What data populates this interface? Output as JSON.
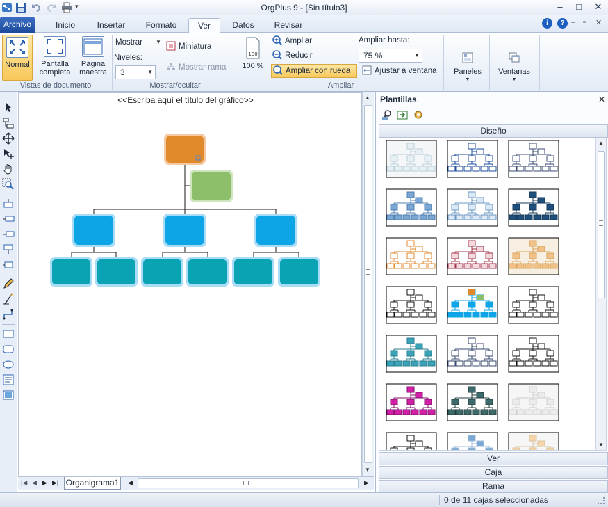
{
  "window": {
    "title": "OrgPlus 9 - [Sin título3]",
    "help_icon": "i",
    "question_icon": "?"
  },
  "tabs": {
    "file": "Archivo",
    "items": [
      "Inicio",
      "Insertar",
      "Formato",
      "Ver",
      "Datos",
      "Revisar"
    ],
    "active": "Ver"
  },
  "ribbon": {
    "vistas": {
      "normal": "Normal",
      "pantalla1": "Pantalla",
      "pantalla2": "completa",
      "pagina1": "Página",
      "pagina2": "maestra",
      "label": "Vistas de documento"
    },
    "mostrar": {
      "mostrar": "Mostrar",
      "niveles": "Niveles:",
      "niveles_value": "3",
      "miniatura": "Miniatura",
      "mostrar_rama": "Mostrar rama",
      "label": "Mostrar/ocultar"
    },
    "ampliar": {
      "percent": "100 %",
      "ampliar": "Ampliar",
      "reducir": "Reducir",
      "rueda": "Ampliar con rueda",
      "hasta": "Ampliar hasta:",
      "hasta_value": "75 %",
      "ajustar": "Ajustar a ventana",
      "label": "Ampliar"
    },
    "paneles": "Paneles",
    "ventanas": "Ventanas"
  },
  "canvas": {
    "chart_title": "<<Escriba aquí el título del gráfico>>",
    "sheet_tab": "Organigrama1"
  },
  "panel": {
    "title": "Plantillas",
    "sections": {
      "diseno": "Diseño",
      "ver": "Ver",
      "caja": "Caja",
      "rama": "Rama"
    }
  },
  "status": {
    "selection": "0 de 11 cajas seleccionadas"
  },
  "colors": {
    "root": "#e08a2c",
    "assistant": "#8dbf6b",
    "level2": "#0ea5e6",
    "level3": "#0aa3b4",
    "accent_blue": "#1d4b9c"
  }
}
